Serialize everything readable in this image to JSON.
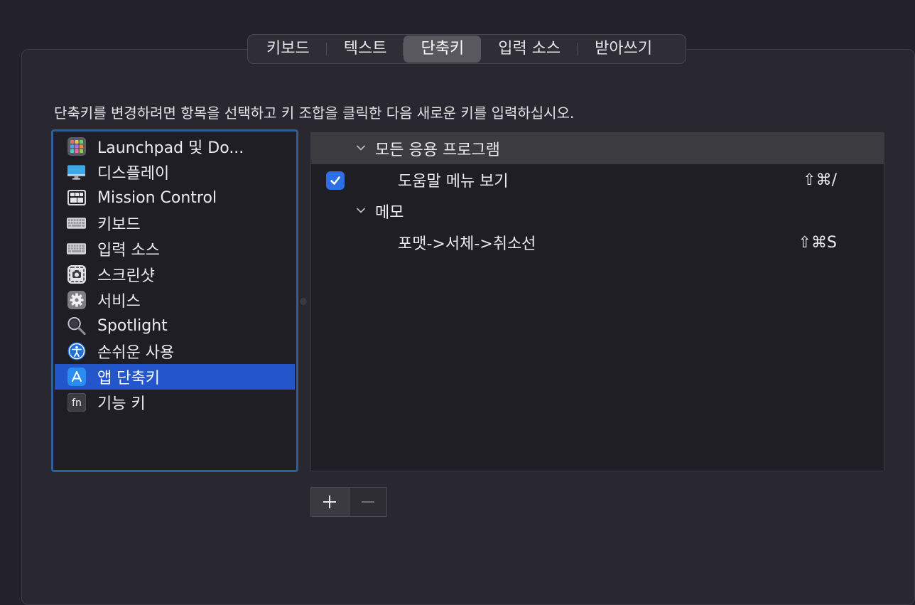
{
  "tabs": [
    {
      "label": "키보드",
      "active": false
    },
    {
      "label": "텍스트",
      "active": false
    },
    {
      "label": "단축키",
      "active": true
    },
    {
      "label": "입력 소스",
      "active": false
    },
    {
      "label": "받아쓰기",
      "active": false
    }
  ],
  "instruction": "단축키를 변경하려면 항목을 선택하고 키 조합을 클릭한 다음 새로운 키를 입력하십시오.",
  "categories": [
    {
      "label": "Launchpad 및 Do...",
      "icon": "launchpad-icon"
    },
    {
      "label": "디스플레이",
      "icon": "display-icon"
    },
    {
      "label": "Mission Control",
      "icon": "mission-control-icon"
    },
    {
      "label": "키보드",
      "icon": "keyboard-icon"
    },
    {
      "label": "입력 소스",
      "icon": "keyboard-icon"
    },
    {
      "label": "스크린샷",
      "icon": "screenshot-icon"
    },
    {
      "label": "서비스",
      "icon": "gear-icon"
    },
    {
      "label": "Spotlight",
      "icon": "magnifier-icon"
    },
    {
      "label": "손쉬운 사용",
      "icon": "accessibility-icon"
    },
    {
      "label": "앱 단축키",
      "icon": "app-store-icon",
      "selected": true
    },
    {
      "label": "기능 키",
      "icon": "fn-key-icon",
      "icon_text": "fn"
    }
  ],
  "shortcuts": {
    "groups": [
      {
        "name": "모든 응용 프로그램",
        "expanded": true,
        "items": [
          {
            "label": "도움말 메뉴 보기",
            "shortcut": "⇧⌘/",
            "checked": true
          }
        ]
      },
      {
        "name": "메모",
        "expanded": true,
        "items": [
          {
            "label": "포맷->서체->취소선",
            "shortcut": "⇧⌘S",
            "checked": false
          }
        ]
      }
    ]
  },
  "colors": {
    "selection": "#2456cb",
    "focus_ring": "#2f5f97",
    "checkbox": "#2f6fe4"
  }
}
